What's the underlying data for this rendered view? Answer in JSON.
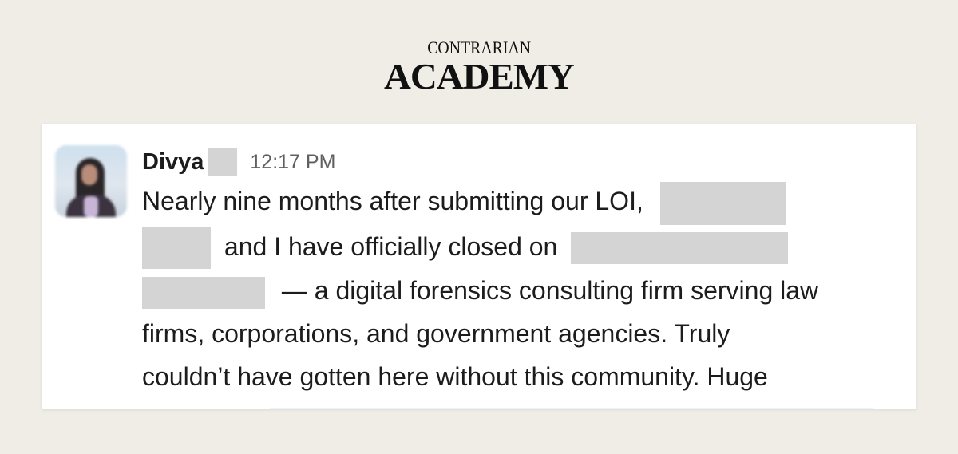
{
  "brand": {
    "top": "CONTRARIAN",
    "main": "ACADEMY"
  },
  "message": {
    "author": "Divya",
    "time": "12:17 PM",
    "lines": [
      "Nearly nine months after submitting our LOI,",
      "and I have officially closed on",
      "— a digital forensics consulting firm serving law",
      "firms, corporations, and government agencies. Truly",
      "couldn’t have gotten here without this community. Huge"
    ]
  },
  "colors": {
    "background": "#efede6",
    "card": "#ffffff",
    "redaction": "#d4d4d4",
    "mention_bg": "#e8f5fa"
  }
}
